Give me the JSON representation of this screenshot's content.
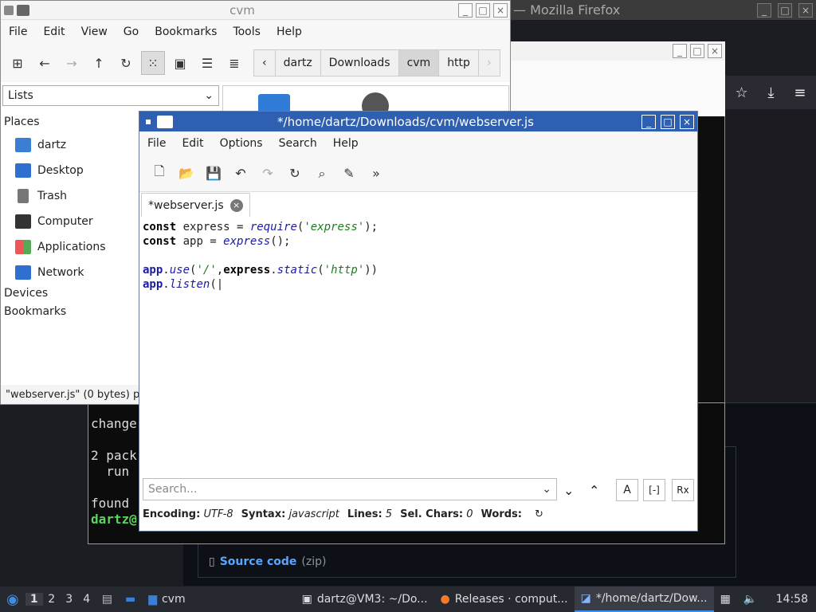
{
  "firefox": {
    "title": "— Mozilla Firefox",
    "source_code": "Source code",
    "source_zip": "(zip)"
  },
  "terminal": {
    "lines": [
      "change",
      "",
      "2 pack",
      "  run",
      "",
      "found",
      "dartz@"
    ]
  },
  "filemanager": {
    "title": "cvm",
    "menu": [
      "File",
      "Edit",
      "View",
      "Go",
      "Bookmarks",
      "Tools",
      "Help"
    ],
    "breadcrumbs": [
      "dartz",
      "Downloads",
      "cvm",
      "http"
    ],
    "side_select": "Lists",
    "places_header": "Places",
    "places": [
      "dartz",
      "Desktop",
      "Trash",
      "Computer",
      "Applications",
      "Network"
    ],
    "devices_header": "Devices",
    "bookmarks_header": "Bookmarks",
    "status": "\"webserver.js\" (0 bytes) p"
  },
  "editor": {
    "title": "*/home/dartz/Downloads/cvm/webserver.js",
    "menu": [
      "File",
      "Edit",
      "Options",
      "Search",
      "Help"
    ],
    "tab_label": "*webserver.js",
    "search_placeholder": "Search...",
    "status": {
      "encoding_label": "Encoding:",
      "encoding": "UTF-8",
      "syntax_label": "Syntax:",
      "syntax": "javascript",
      "lines_label": "Lines:",
      "lines": "5",
      "sel_label": "Sel. Chars:",
      "sel": "0",
      "words_label": "Words:"
    }
  },
  "taskbar": {
    "desktops": [
      "1",
      "2",
      "3",
      "4"
    ],
    "items": [
      "cvm",
      "dartz@VM3: ~/Do...",
      "Releases · comput...",
      "*/home/dartz/Dow..."
    ],
    "clock": "14:58"
  }
}
